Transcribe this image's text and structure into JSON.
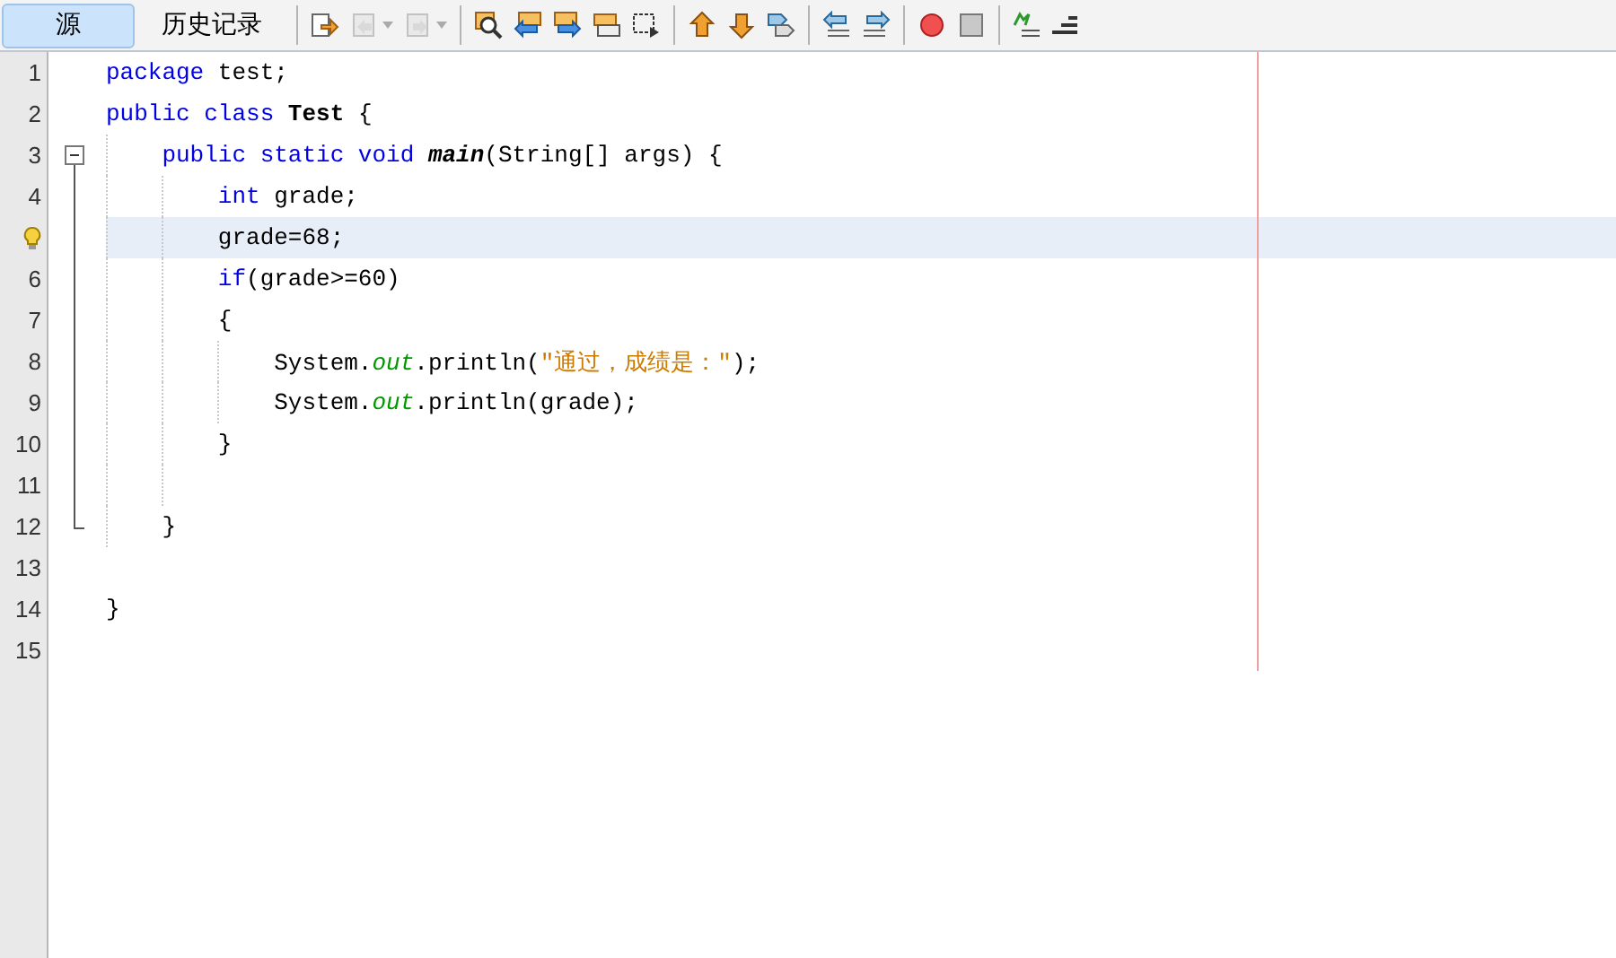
{
  "tabs": [
    {
      "label": "源",
      "selected": true
    },
    {
      "label": "历史记录",
      "selected": false
    }
  ],
  "toolbar": {
    "groups": [
      [
        {
          "kind": "last-edit",
          "disabled": false
        },
        {
          "kind": "back",
          "disabled": true,
          "dropdown": true
        },
        {
          "kind": "forward",
          "disabled": true,
          "dropdown": true
        }
      ],
      [
        {
          "kind": "find",
          "disabled": false
        },
        {
          "kind": "find-prev",
          "disabled": false
        },
        {
          "kind": "find-next",
          "disabled": false
        },
        {
          "kind": "highlight",
          "disabled": false
        },
        {
          "kind": "rect-select",
          "disabled": false
        }
      ],
      [
        {
          "kind": "prev-bookmark",
          "disabled": false
        },
        {
          "kind": "next-bookmark",
          "disabled": false
        },
        {
          "kind": "toggle-bookmark",
          "disabled": false
        }
      ],
      [
        {
          "kind": "shift-left",
          "disabled": false
        },
        {
          "kind": "shift-right",
          "disabled": false
        }
      ],
      [
        {
          "kind": "record",
          "disabled": false
        },
        {
          "kind": "stop",
          "disabled": false
        }
      ],
      [
        {
          "kind": "comment",
          "disabled": false
        },
        {
          "kind": "uncomment",
          "disabled": false
        }
      ]
    ]
  },
  "editor": {
    "lines": [
      {
        "number": "1",
        "tokens": [
          {
            "kind": "keyword",
            "text": "package"
          },
          {
            "kind": "plain",
            "text": " test;"
          }
        ]
      },
      {
        "number": "2",
        "tokens": [
          {
            "kind": "keyword",
            "text": "public class "
          },
          {
            "kind": "name",
            "text": "Test"
          },
          {
            "kind": "plain",
            "text": " {"
          }
        ]
      },
      {
        "number": "3",
        "fold_start": true,
        "tokens": [
          {
            "kind": "keyword",
            "text": "    public static void "
          },
          {
            "kind": "method",
            "text": "main"
          },
          {
            "kind": "plain",
            "text": "(String[] args) {"
          }
        ]
      },
      {
        "number": "4",
        "tokens": [
          {
            "kind": "keyword",
            "text": "        int"
          },
          {
            "kind": "plain",
            "text": " grade;"
          }
        ]
      },
      {
        "hint": true,
        "current": true,
        "tokens": [
          {
            "kind": "plain",
            "text": "        grade=68;"
          }
        ]
      },
      {
        "number": "6",
        "tokens": [
          {
            "kind": "keyword",
            "text": "        if"
          },
          {
            "kind": "plain",
            "text": "(grade>=60)"
          }
        ]
      },
      {
        "number": "7",
        "tokens": [
          {
            "kind": "plain",
            "text": "        {"
          }
        ]
      },
      {
        "number": "8",
        "tokens": [
          {
            "kind": "plain",
            "text": "            System."
          },
          {
            "kind": "field",
            "text": "out"
          },
          {
            "kind": "plain",
            "text": ".println("
          },
          {
            "kind": "string",
            "text": "\"通过，成绩是：\""
          },
          {
            "kind": "plain",
            "text": ");"
          }
        ]
      },
      {
        "number": "9",
        "tokens": [
          {
            "kind": "plain",
            "text": "            System."
          },
          {
            "kind": "field",
            "text": "out"
          },
          {
            "kind": "plain",
            "text": ".println(grade);"
          }
        ]
      },
      {
        "number": "10",
        "tokens": [
          {
            "kind": "plain",
            "text": "        }"
          }
        ]
      },
      {
        "number": "11"
      },
      {
        "number": "12",
        "fold_end": true,
        "tokens": [
          {
            "kind": "plain",
            "text": "    }"
          }
        ]
      },
      {
        "number": "13"
      },
      {
        "number": "14",
        "tokens": [
          {
            "kind": "plain",
            "text": "}"
          }
        ]
      },
      {
        "number": "15"
      }
    ]
  }
}
